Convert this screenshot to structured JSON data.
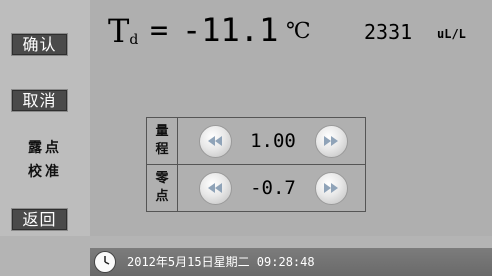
{
  "sidebar": {
    "confirm_label": "确认",
    "cancel_label": "取消",
    "mode_label_line1": "露点",
    "mode_label_line2": "校准",
    "back_label": "返回"
  },
  "reading": {
    "symbol": "T",
    "subscript": "d",
    "equals": "=",
    "value": "-11.1",
    "unit": "℃"
  },
  "flow": {
    "value": "2331",
    "unit": "uL/L"
  },
  "calibration": {
    "range": {
      "label_line1": "量",
      "label_line2": "程",
      "value": "1.00",
      "decrease_icon": "rewind-icon",
      "increase_icon": "fast-forward-icon"
    },
    "zero": {
      "label_line1": "零",
      "label_line2": "点",
      "value": "-0.7",
      "decrease_icon": "rewind-icon",
      "increase_icon": "fast-forward-icon"
    }
  },
  "status_bar": {
    "icon": "clock-icon",
    "datetime": "2012年5月15日星期二 09:28:48"
  },
  "colors": {
    "background": "#b4b4b4",
    "button_bg": "#4a4a4a",
    "status_bar": "#727272"
  }
}
